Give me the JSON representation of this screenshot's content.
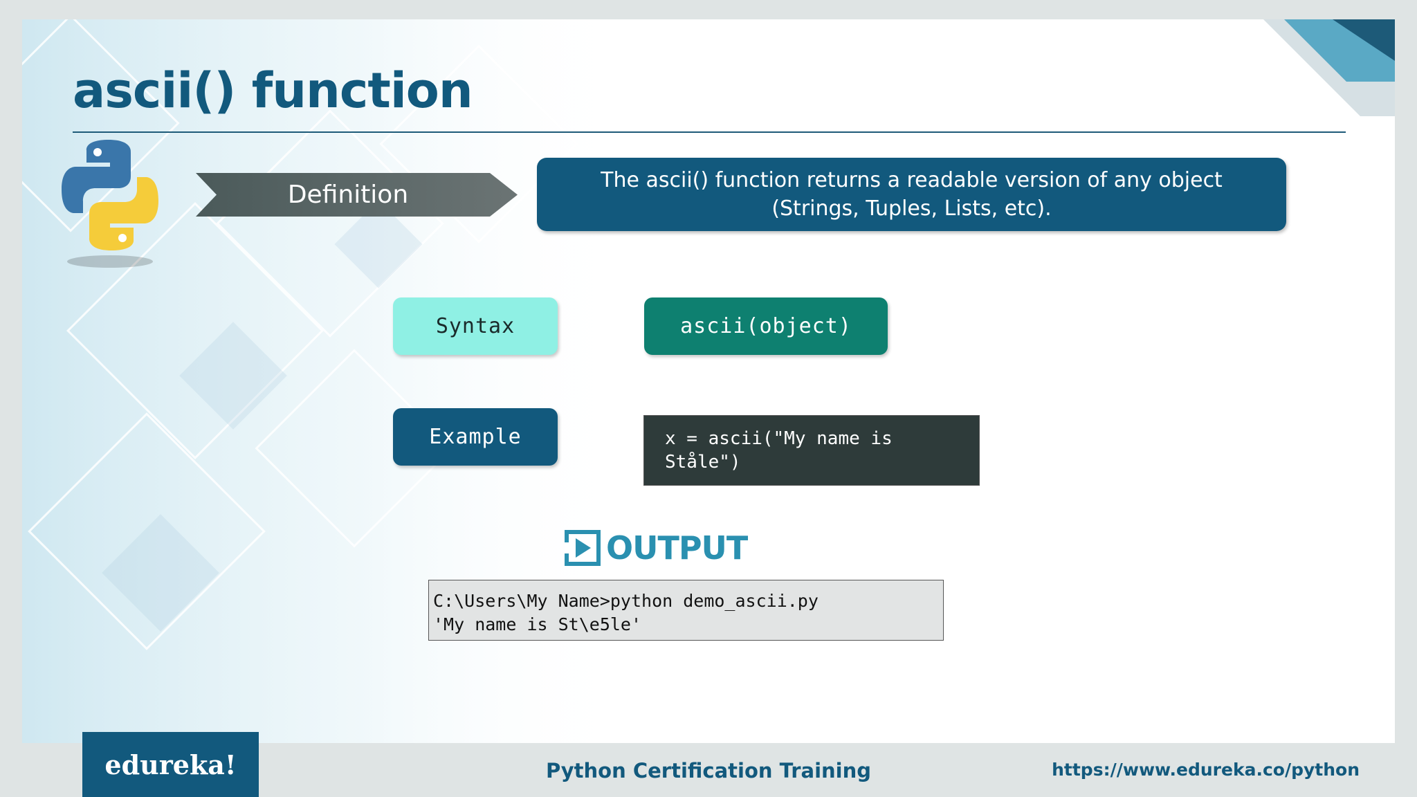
{
  "slide": {
    "title": "ascii() function",
    "definition_label": "Definition",
    "definition_text": "The ascii() function returns a readable version of any object (Strings, Tuples, Lists, etc).",
    "syntax_label": "Syntax",
    "syntax_code": "ascii(object)",
    "example_label": "Example",
    "example_code": "x = ascii(\"My name is\nStåle\")",
    "output_label": "OUTPUT",
    "output_lines": "C:\\Users\\My Name>python demo_ascii.py\n'My name is St\\e5le'"
  },
  "footer": {
    "brand": "edureka!",
    "course": "Python Certification Training",
    "url": "https://www.edureka.co/python"
  },
  "colors": {
    "primary": "#12597d",
    "syntax_pill": "#8ff0e4",
    "syntax_code": "#0e8070",
    "code_bg": "#2e3b3a",
    "output_accent": "#2a90b0"
  },
  "icons": {
    "logo": "python-logo-icon",
    "arrow": "definition-arrow-shape",
    "output": "play-box-icon"
  }
}
